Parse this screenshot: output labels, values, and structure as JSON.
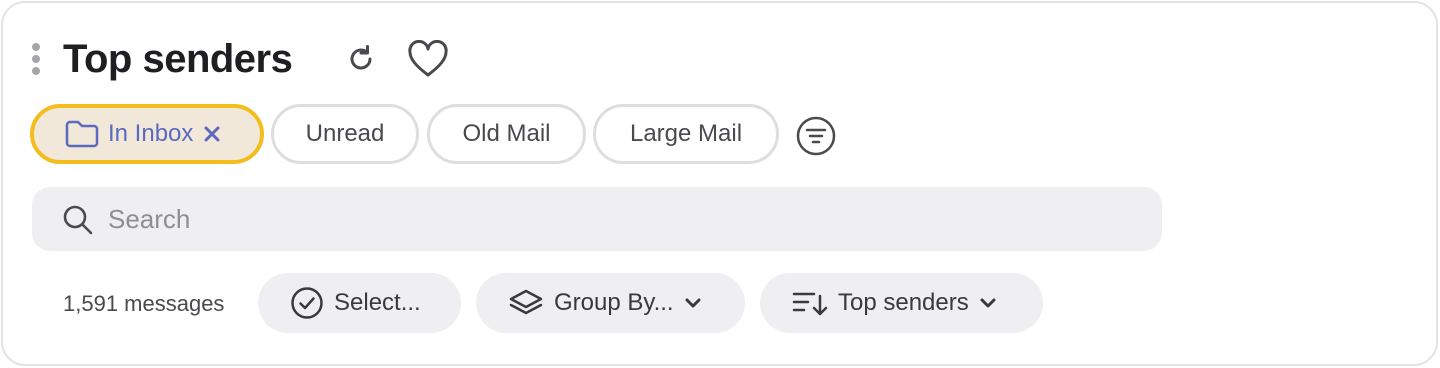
{
  "header": {
    "title": "Top senders"
  },
  "filters": {
    "chips": [
      {
        "label": "In Inbox",
        "active": true
      },
      {
        "label": "Unread",
        "active": false
      },
      {
        "label": "Old Mail",
        "active": false
      },
      {
        "label": "Large Mail",
        "active": false
      }
    ]
  },
  "search": {
    "placeholder": "Search",
    "value": ""
  },
  "toolbar": {
    "message_count": "1,591 messages",
    "select_label": "Select...",
    "group_by_label": "Group By...",
    "sort_label": "Top senders"
  },
  "icons": {
    "header": [
      "drag-handle-icon",
      "refresh-icon",
      "heart-icon"
    ],
    "filters": [
      "folder-icon",
      "close-icon",
      "filter-icon"
    ],
    "search": [
      "search-icon"
    ],
    "toolbar": [
      "check-circle-icon",
      "layers-icon",
      "sort-icon",
      "chevron-down-icon"
    ]
  },
  "colors": {
    "active_chip_bg": "#f2e8d9",
    "active_chip_border": "#f3bd1d",
    "active_chip_text": "#5a6ac0",
    "search_bg": "#efeff1",
    "pill_bg": "#efeff1"
  }
}
